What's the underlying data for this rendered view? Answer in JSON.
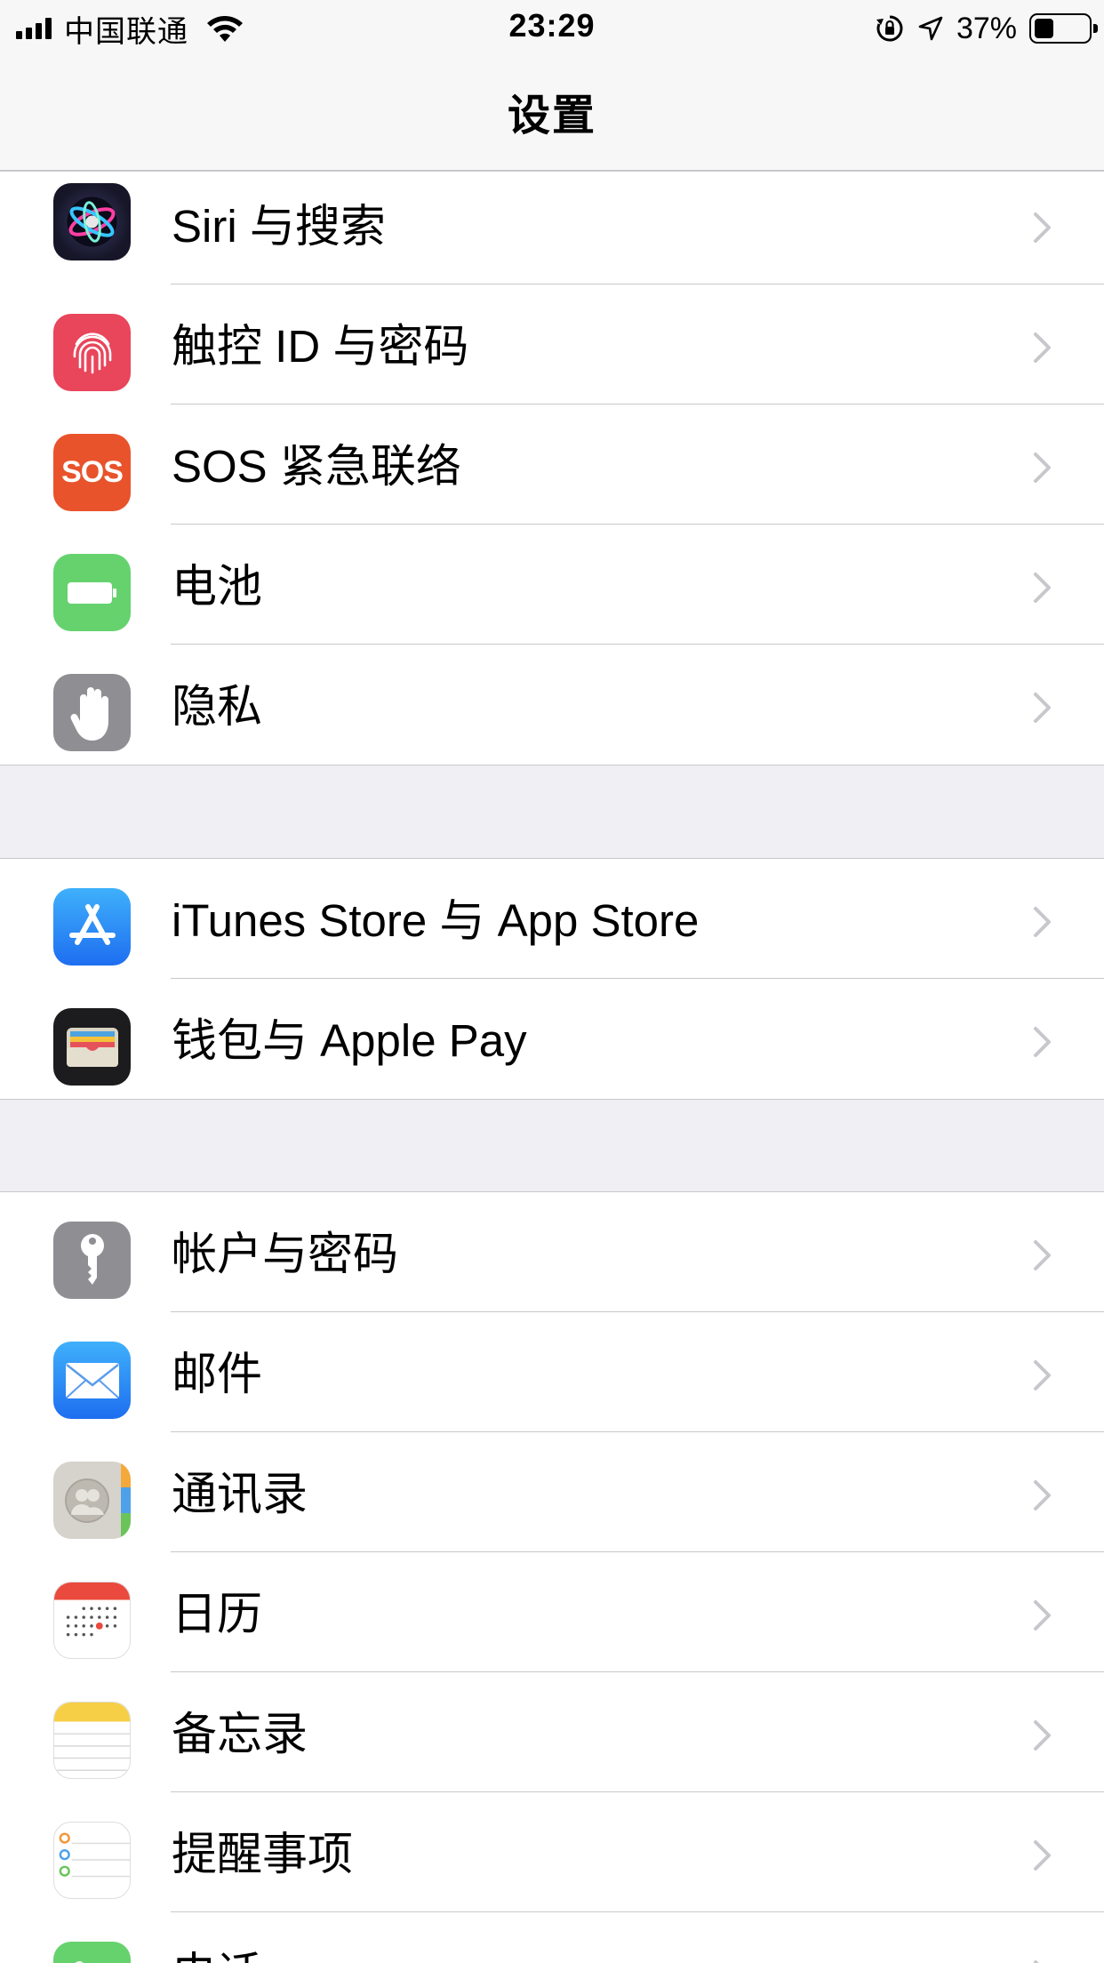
{
  "status_bar": {
    "carrier": "中国联通",
    "time": "23:29",
    "battery_percent": "37%",
    "battery_level": 0.37,
    "icons": [
      "signal-icon",
      "wifi-icon",
      "orientation-lock-icon",
      "location-icon",
      "battery-icon"
    ]
  },
  "nav": {
    "title": "设置"
  },
  "groups": [
    {
      "items": [
        {
          "label": "Siri 与搜索",
          "icon": "siri-icon",
          "color": "#1c1c2e"
        },
        {
          "label": "触控 ID 与密码",
          "icon": "fingerprint-icon",
          "color": "#e9455b"
        },
        {
          "label": "SOS 紧急联络",
          "icon": "sos-icon",
          "icon_text": "SOS",
          "color": "#e8532b"
        },
        {
          "label": "电池",
          "icon": "battery-icon",
          "color": "#65d26e"
        },
        {
          "label": "隐私",
          "icon": "hand-icon",
          "color": "#8e8e93"
        }
      ]
    },
    {
      "items": [
        {
          "label": "iTunes Store 与 App Store",
          "icon": "app-store-icon",
          "color": "#2f8cf6"
        },
        {
          "label": "钱包与 Apple Pay",
          "icon": "wallet-icon",
          "color": "#1c1c1e"
        }
      ]
    },
    {
      "items": [
        {
          "label": "帐户与密码",
          "icon": "key-icon",
          "color": "#8e8e93"
        },
        {
          "label": "邮件",
          "icon": "mail-icon",
          "color": "#2f8cf6"
        },
        {
          "label": "通讯录",
          "icon": "contacts-icon",
          "color": "#d6d3cc"
        },
        {
          "label": "日历",
          "icon": "calendar-icon",
          "color": "#ffffff"
        },
        {
          "label": "备忘录",
          "icon": "notes-icon",
          "color": "#ffffff"
        },
        {
          "label": "提醒事项",
          "icon": "reminders-icon",
          "color": "#ffffff"
        },
        {
          "label": "电话",
          "icon": "phone-icon",
          "color": "#65d26e"
        }
      ]
    }
  ]
}
